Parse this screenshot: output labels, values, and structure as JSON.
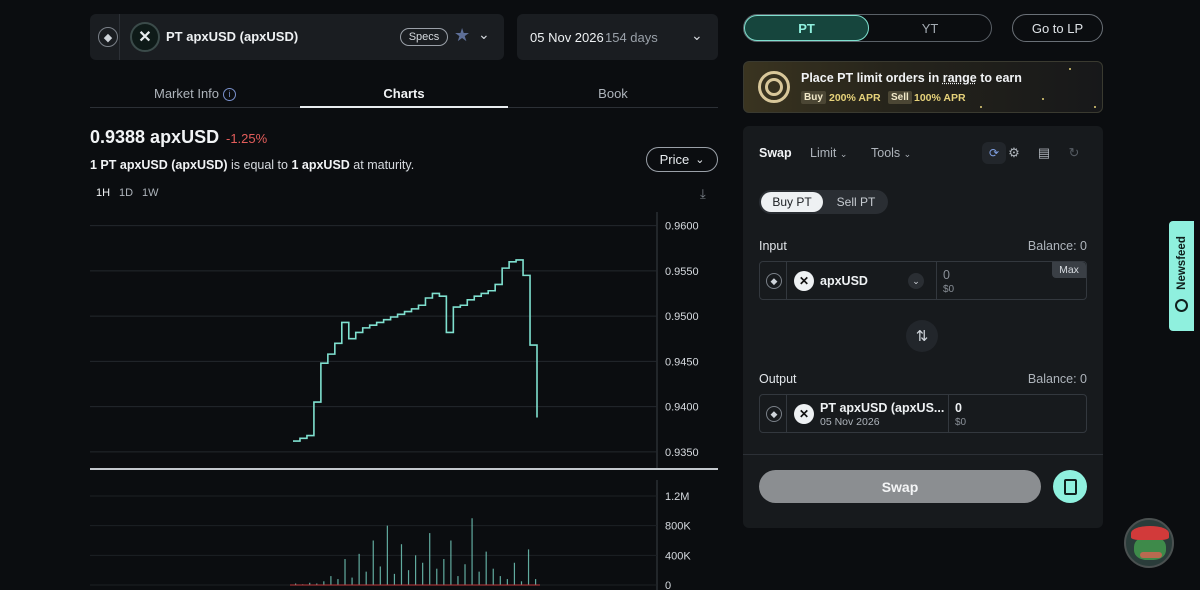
{
  "market": {
    "chain_icon": "ethereum-icon",
    "token_icon": "apex-x-logo",
    "name": "PT apxUSD (apxUSD)",
    "specs_label": "Specs",
    "maturity_date": "05 Nov 2026",
    "days_left": "154 days"
  },
  "tabs": [
    {
      "label": "Market Info"
    },
    {
      "label": "Charts"
    },
    {
      "label": "Book"
    }
  ],
  "active_tab": "Charts",
  "price": {
    "value": "0.9388 apxUSD",
    "change": "-1.25%",
    "eq_prefix": "1 PT apxUSD (apxUSD)",
    "eq_mid": " is equal to ",
    "eq_token": "1 apxUSD",
    "eq_suffix": " at maturity."
  },
  "chart_controls": {
    "metric_label": "Price",
    "timeframes": [
      "1H",
      "1D",
      "1W"
    ],
    "active_timeframe": "1H"
  },
  "chart_data": [
    {
      "type": "line",
      "series": [
        {
          "values": [
            0.9362,
            0.9365,
            0.9368,
            0.9405,
            0.9448,
            0.9458,
            0.947,
            0.9493,
            0.9475,
            0.9482,
            0.9487,
            0.949,
            0.9493,
            0.9496,
            0.9499,
            0.9502,
            0.9505,
            0.9508,
            0.9512,
            0.952,
            0.9525,
            0.9522,
            0.9482,
            0.951,
            0.9512,
            0.9518,
            0.9522,
            0.9525,
            0.9528,
            0.9535,
            0.9553,
            0.956,
            0.9562,
            0.9545,
            0.9468,
            0.9388
          ]
        }
      ],
      "yticks": [
        "0.9600",
        "0.9550",
        "0.9500",
        "0.9450",
        "0.9400",
        "0.9350"
      ],
      "ylim": [
        0.933,
        0.9615
      ],
      "line_color": "#7fe0cf",
      "grid": true,
      "yaxis_position": "right"
    },
    {
      "type": "bar",
      "series": [
        {
          "values": [
            0.02,
            0.01,
            0.03,
            0.02,
            0.05,
            0.12,
            0.08,
            0.35,
            0.1,
            0.42,
            0.18,
            0.6,
            0.25,
            0.8,
            0.15,
            0.55,
            0.2,
            0.4,
            0.3,
            0.7,
            0.22,
            0.35,
            0.6,
            0.12,
            0.28,
            0.9,
            0.18,
            0.45,
            0.22,
            0.12,
            0.08,
            0.3,
            0.05,
            0.48,
            0.08
          ]
        }
      ],
      "yticks": [
        "1.2M",
        "800K",
        "400K",
        "0"
      ],
      "ylim": [
        0,
        1.2
      ],
      "bar_color": "#7fe0cf"
    }
  ],
  "right_panel": {
    "pt_label": "PT",
    "yt_label": "YT",
    "lp_label": "Go to LP",
    "promo": {
      "title_prefix": "Place PT limit orders in ",
      "title_range": "range",
      "title_suffix": " to earn",
      "buy_label": "Buy",
      "buy_apr": "200% APR",
      "sell_label": "Sell",
      "sell_apr": "100% APR"
    },
    "swap_tabs": [
      "Swap",
      "Limit",
      "Tools"
    ],
    "buy_label": "Buy PT",
    "sell_label": "Sell PT",
    "input": {
      "label": "Input",
      "balance": "Balance: 0",
      "token": "apxUSD",
      "amount": "0",
      "usd": "$0",
      "max_label": "Max"
    },
    "output": {
      "label": "Output",
      "balance": "Balance: 0",
      "token": "PT apxUSD (apxUS...",
      "subtitle": "05 Nov 2026",
      "amount": "0",
      "usd": "$0"
    },
    "swap_button": "Swap"
  },
  "newsfeed_label": "Newsfeed"
}
